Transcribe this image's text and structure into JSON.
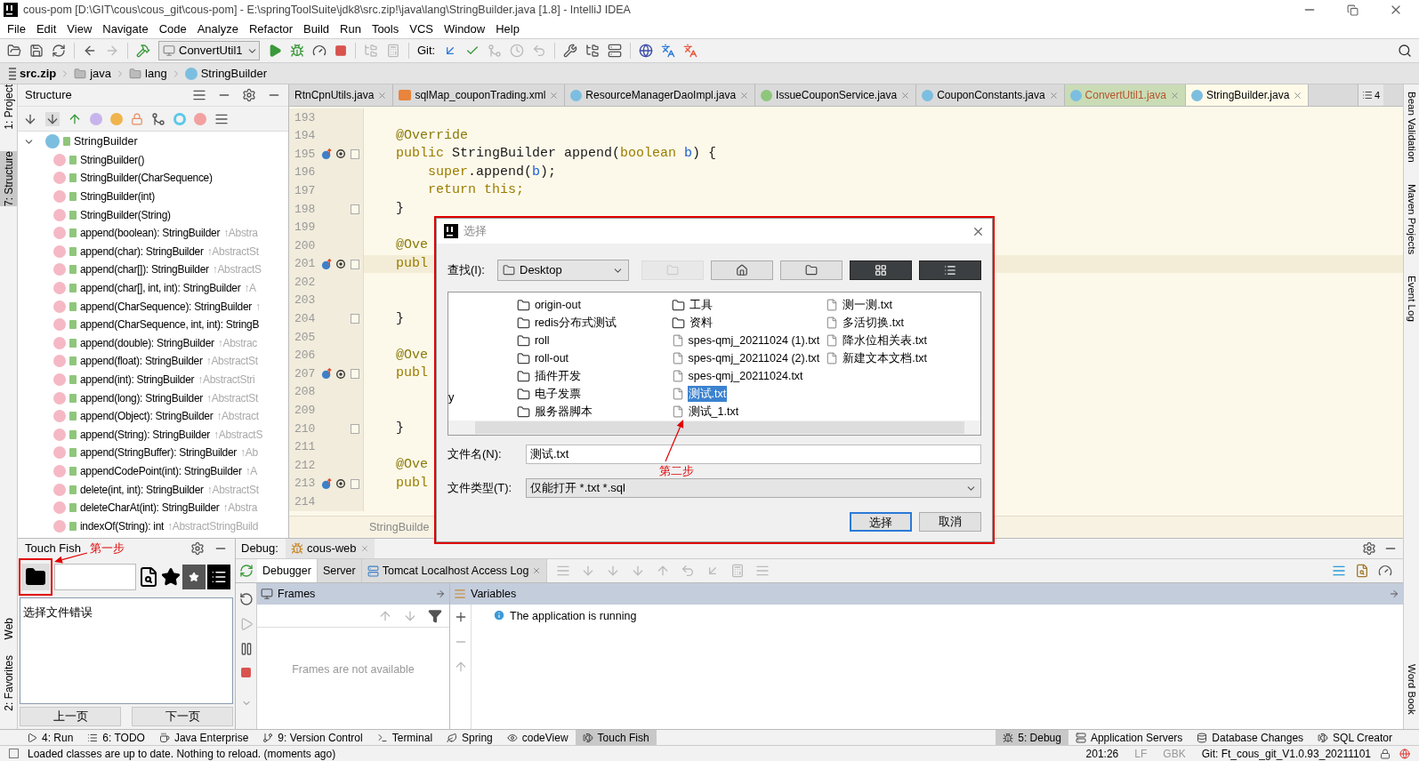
{
  "window": {
    "title": "cous-pom [D:\\GIT\\cous\\cous_git\\cous-pom] - E:\\springToolSuite\\jdk8\\src.zip!\\java\\lang\\StringBuilder.java [1.8] - IntelliJ IDEA"
  },
  "menu": [
    "File",
    "Edit",
    "View",
    "Navigate",
    "Code",
    "Analyze",
    "Refactor",
    "Build",
    "Run",
    "Tools",
    "VCS",
    "Window",
    "Help"
  ],
  "toolbar": {
    "run_config": "ConvertUtil1",
    "git_label": "Git:"
  },
  "breadcrumb": [
    {
      "label": "src.zip",
      "kind": "archive"
    },
    {
      "label": "java",
      "kind": "folder"
    },
    {
      "label": "lang",
      "kind": "folder"
    },
    {
      "label": "StringBuilder",
      "kind": "class"
    }
  ],
  "left_stripe": [
    {
      "label": "1: Project",
      "selected": false
    },
    {
      "label": "7: Structure",
      "selected": true
    }
  ],
  "left_stripe_bottom": [
    {
      "label": "Web",
      "selected": false
    },
    {
      "label": "2: Favorites",
      "selected": false
    }
  ],
  "structure": {
    "title": "Structure",
    "tree": {
      "label": "StringBuilder",
      "expanded": true,
      "children": [
        {
          "label": "StringBuilder()"
        },
        {
          "label": "StringBuilder(CharSequence)"
        },
        {
          "label": "StringBuilder(int)"
        },
        {
          "label": "StringBuilder(String)"
        },
        {
          "label": "append(boolean): StringBuilder",
          "inherited": "↑Abstra"
        },
        {
          "label": "append(char): StringBuilder",
          "inherited": "↑AbstractSt"
        },
        {
          "label": "append(char[]): StringBuilder",
          "inherited": "↑AbstractS"
        },
        {
          "label": "append(char[], int, int): StringBuilder",
          "inherited": "↑A"
        },
        {
          "label": "append(CharSequence): StringBuilder",
          "inherited": "↑"
        },
        {
          "label": "append(CharSequence, int, int): StringB"
        },
        {
          "label": "append(double): StringBuilder",
          "inherited": "↑Abstrac"
        },
        {
          "label": "append(float): StringBuilder",
          "inherited": "↑AbstractSt"
        },
        {
          "label": "append(int): StringBuilder",
          "inherited": "↑AbstractStri"
        },
        {
          "label": "append(long): StringBuilder",
          "inherited": "↑AbstractSt"
        },
        {
          "label": "append(Object): StringBuilder",
          "inherited": "↑Abstract"
        },
        {
          "label": "append(String): StringBuilder",
          "inherited": "↑AbstractS"
        },
        {
          "label": "append(StringBuffer): StringBuilder",
          "inherited": "↑Ab"
        },
        {
          "label": "appendCodePoint(int): StringBuilder",
          "inherited": "↑A"
        },
        {
          "label": "delete(int, int): StringBuilder",
          "inherited": "↑AbstractSt"
        },
        {
          "label": "deleteCharAt(int): StringBuilder",
          "inherited": "↑Abstra"
        },
        {
          "label": "indexOf(String): int",
          "inherited": "↑AbstractStringBuild"
        }
      ]
    }
  },
  "editor": {
    "tabs": [
      {
        "label": "RtnCpnUtils.java",
        "selected": false,
        "highlighted": false
      },
      {
        "label": "sqlMap_couponTrading.xml",
        "kind": "xml",
        "selected": false,
        "highlighted": false
      },
      {
        "label": "ResourceManagerDaoImpl.java",
        "kind": "class",
        "selected": false,
        "highlighted": false
      },
      {
        "label": "IssueCouponService.java",
        "kind": "interface",
        "selected": false,
        "highlighted": false
      },
      {
        "label": "CouponConstants.java",
        "kind": "class",
        "selected": false,
        "highlighted": false
      },
      {
        "label": "ConvertUtil1.java",
        "kind": "class",
        "selected": false,
        "highlighted": true
      },
      {
        "label": "StringBuilder.java",
        "kind": "class",
        "selected": true,
        "highlighted": false
      }
    ],
    "tab_count": "4",
    "lines": [
      {
        "number": "193",
        "current": false,
        "marker": false,
        "fold": false
      },
      {
        "number": "194",
        "current": false,
        "marker": false,
        "fold": false,
        "segments": [
          {
            "text": "    @Override",
            "kind": "annotation"
          }
        ]
      },
      {
        "number": "195",
        "current": false,
        "marker": true,
        "fold": true,
        "segments": [
          {
            "text": "    public",
            "kind": "keyword"
          },
          {
            "text": " StringBuilder append(",
            "kind": "plain"
          },
          {
            "text": "boolean",
            "kind": "keyword"
          },
          {
            "text": " b",
            "kind": "param"
          },
          {
            "text": ") {",
            "kind": "plain"
          }
        ]
      },
      {
        "number": "196",
        "current": false,
        "marker": false,
        "fold": false,
        "segments": [
          {
            "text": "        super",
            "kind": "keyword"
          },
          {
            "text": ".append(",
            "kind": "plain"
          },
          {
            "text": "b",
            "kind": "param"
          },
          {
            "text": ");",
            "kind": "plain"
          }
        ]
      },
      {
        "number": "197",
        "current": false,
        "marker": false,
        "fold": false,
        "segments": [
          {
            "text": "        return this;",
            "kind": "keyword"
          }
        ]
      },
      {
        "number": "198",
        "current": false,
        "marker": false,
        "fold": true,
        "segments": [
          {
            "text": "    }",
            "kind": "plain"
          }
        ]
      },
      {
        "number": "199",
        "current": false,
        "marker": false,
        "fold": false
      },
      {
        "number": "200",
        "current": false,
        "marker": false,
        "fold": false,
        "segments": [
          {
            "text": "    @Ove",
            "kind": "annotation"
          }
        ]
      },
      {
        "number": "201",
        "current": true,
        "marker": true,
        "fold": true,
        "segments": [
          {
            "text": "    publ",
            "kind": "keyword"
          }
        ]
      },
      {
        "number": "202",
        "current": false,
        "marker": false,
        "fold": false
      },
      {
        "number": "203",
        "current": false,
        "marker": false,
        "fold": false
      },
      {
        "number": "204",
        "current": false,
        "marker": false,
        "fold": true,
        "segments": [
          {
            "text": "    }",
            "kind": "plain"
          }
        ]
      },
      {
        "number": "205",
        "current": false,
        "marker": false,
        "fold": false
      },
      {
        "number": "206",
        "current": false,
        "marker": false,
        "fold": false,
        "segments": [
          {
            "text": "    @Ove",
            "kind": "annotation"
          }
        ]
      },
      {
        "number": "207",
        "current": false,
        "marker": true,
        "fold": true,
        "segments": [
          {
            "text": "    publ",
            "kind": "keyword"
          }
        ]
      },
      {
        "number": "208",
        "current": false,
        "marker": false,
        "fold": false
      },
      {
        "number": "209",
        "current": false,
        "marker": false,
        "fold": false
      },
      {
        "number": "210",
        "current": false,
        "marker": false,
        "fold": true,
        "segments": [
          {
            "text": "    }",
            "kind": "plain"
          }
        ]
      },
      {
        "number": "211",
        "current": false,
        "marker": false,
        "fold": false
      },
      {
        "number": "212",
        "current": false,
        "marker": false,
        "fold": false,
        "segments": [
          {
            "text": "    @Ove",
            "kind": "annotation"
          }
        ]
      },
      {
        "number": "213",
        "current": false,
        "marker": true,
        "fold": true,
        "segments": [
          {
            "text": "    publ",
            "kind": "keyword"
          }
        ]
      },
      {
        "number": "214",
        "current": false,
        "marker": false,
        "fold": false
      }
    ],
    "breadcrumb": "StringBuilde"
  },
  "dialog": {
    "title": "选择",
    "look_in_label": "查找(I):",
    "look_in": "Desktop",
    "partial_item": "y",
    "columns": [
      [
        {
          "name": "origin-out",
          "kind": "folder",
          "selected": false
        },
        {
          "name": "redis分布式测试",
          "kind": "folder",
          "selected": false
        },
        {
          "name": "roll",
          "kind": "folder",
          "selected": false
        },
        {
          "name": "roll-out",
          "kind": "folder",
          "selected": false
        },
        {
          "name": "插件开发",
          "kind": "folder",
          "selected": false
        },
        {
          "name": "电子发票",
          "kind": "folder",
          "selected": false
        },
        {
          "name": "服务器脚本",
          "kind": "folder",
          "selected": false
        }
      ],
      [
        {
          "name": "工具",
          "kind": "folder",
          "selected": false
        },
        {
          "name": "资料",
          "kind": "folder",
          "selected": false
        },
        {
          "name": "spes-qmj_20211024 (1).txt",
          "kind": "file",
          "selected": false
        },
        {
          "name": "spes-qmj_20211024 (2).txt",
          "kind": "file",
          "selected": false
        },
        {
          "name": "spes-qmj_20211024.txt",
          "kind": "file",
          "selected": false
        },
        {
          "name": "测试.txt",
          "kind": "file",
          "selected": true
        },
        {
          "name": "测试_1.txt",
          "kind": "file",
          "selected": false
        }
      ],
      [
        {
          "name": "测一测.txt",
          "kind": "file",
          "selected": false
        },
        {
          "name": "多活切换.txt",
          "kind": "file",
          "selected": false
        },
        {
          "name": "降水位相关表.txt",
          "kind": "file",
          "selected": false
        },
        {
          "name": "新建文本文档.txt",
          "kind": "file",
          "selected": false
        }
      ]
    ],
    "file_name_label": "文件名(N):",
    "file_name": "测试.txt",
    "file_type_label": "文件类型(T):",
    "file_type": "仅能打开 *.txt *.sql",
    "buttons": [
      {
        "label": "选择",
        "default": true
      },
      {
        "label": "取消",
        "default": false
      }
    ]
  },
  "annotations": [
    "第一步",
    "第二步"
  ],
  "touch_fish": {
    "title": "Touch Fish",
    "message": "选择文件错误",
    "buttons": [
      "上一页",
      "下一页"
    ]
  },
  "debug": {
    "label": "Debug:",
    "session": "cous-web",
    "tabs": [
      {
        "label": "Debugger",
        "selected": true
      },
      {
        "label": "Server",
        "selected": false
      },
      {
        "label": "Tomcat Localhost Access Log",
        "selected": false
      }
    ],
    "frames": {
      "title": "Frames",
      "empty": "Frames are not available"
    },
    "variables": {
      "title": "Variables",
      "message": "The application is running"
    }
  },
  "right_stripe": [
    "Bean Validation",
    "Maven Projects",
    "Event Log"
  ],
  "right_stripe_bottom": [
    "Word Book"
  ],
  "tool_windows_left": [
    {
      "label": "4: Run",
      "selected": false
    },
    {
      "label": "6: TODO",
      "selected": false
    },
    {
      "label": "Java Enterprise",
      "selected": false
    },
    {
      "label": "9: Version Control",
      "selected": false
    },
    {
      "label": "Terminal",
      "selected": false
    },
    {
      "label": "Spring",
      "selected": false
    },
    {
      "label": "codeView",
      "selected": false
    },
    {
      "label": "Touch Fish",
      "selected": true
    }
  ],
  "tool_windows_right": [
    {
      "label": "5: Debug",
      "selected": true
    },
    {
      "label": "Application Servers",
      "selected": false
    },
    {
      "label": "Database Changes",
      "selected": false
    },
    {
      "label": "SQL Creator",
      "selected": false
    }
  ],
  "status_bar": {
    "message": "Loaded classes are up to date. Nothing to reload. (moments ago)",
    "position": "201:26",
    "line_separator": "LF",
    "encoding": "GBK",
    "vcs": "Git: Ft_cous_git_V1.0.93_20211101"
  }
}
